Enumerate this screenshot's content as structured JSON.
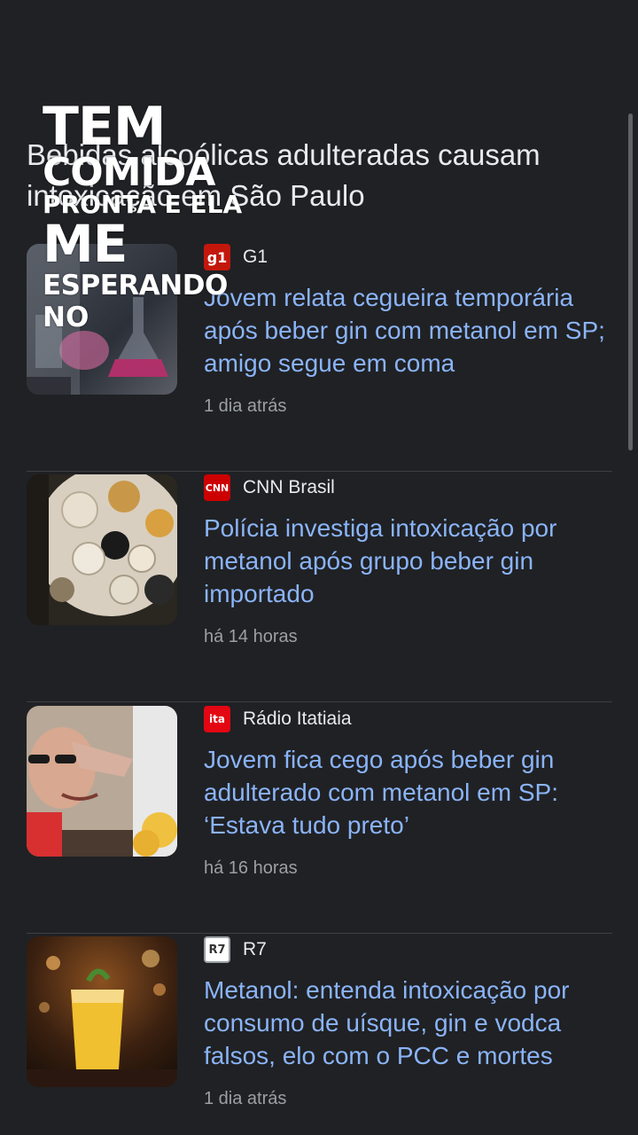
{
  "topic": {
    "title": "Bebidas alcoólicas adulteradas causam intoxicação em São Paulo"
  },
  "video_overlay": {
    "lines": [
      "TEM",
      "COMIDA",
      "PRONTA E ELA",
      "ME",
      "ESPERANDO",
      "NO"
    ]
  },
  "articles": [
    {
      "source": "G1",
      "logo_text": "g1",
      "logo_color": "#c4170c",
      "headline": "Jovem relata cegueira temporária após beber gin com metanol em SP; amigo segue em coma",
      "time": "1 dia atrás",
      "thumb_icon": "lab-flask-image"
    },
    {
      "source": "CNN Brasil",
      "logo_text": "CNN",
      "logo_color": "#cc0000",
      "headline": "Polícia investiga intoxicação por metanol após grupo beber gin importado",
      "time": "há 14 horas",
      "thumb_icon": "glasses-table-image"
    },
    {
      "source": "Rádio Itatiaia",
      "logo_text": "ita",
      "logo_color": "#e30613",
      "headline": "Jovem fica cego após beber gin adulterado com metanol em SP: ‘Estava tudo preto’",
      "time": "há 16 horas",
      "thumb_icon": "young-man-image"
    },
    {
      "source": "R7",
      "logo_text": "R7",
      "logo_color": "#ffffff",
      "headline": "Metanol: entenda intoxicação por consumo de uísque, gin e vodca falsos, elo com o PCC e mortes",
      "time": "1 dia atrás",
      "thumb_icon": "cocktail-glass-image"
    }
  ]
}
